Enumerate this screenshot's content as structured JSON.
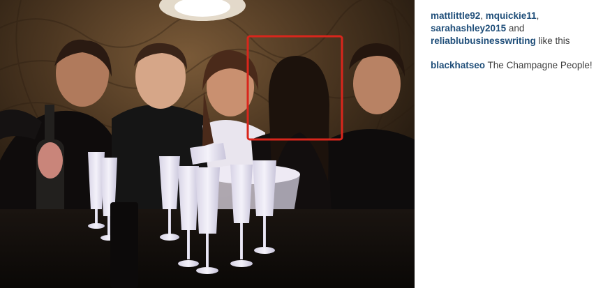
{
  "photo": {
    "alt_hint": "group-photo",
    "highlight_color": "#d9261c"
  },
  "likes": {
    "users": [
      "mattlittle92",
      "mquickie11",
      "sarahashley2015",
      "reliablubusinesswriting"
    ],
    "sep1": ", ",
    "sep2": ",",
    "sep3": " and",
    "suffix": " like this"
  },
  "comment": {
    "username": "blackhatseo",
    "text": " The Champagne People!"
  },
  "colors": {
    "username": "#1f4e79",
    "text": "#3d3d3d"
  }
}
